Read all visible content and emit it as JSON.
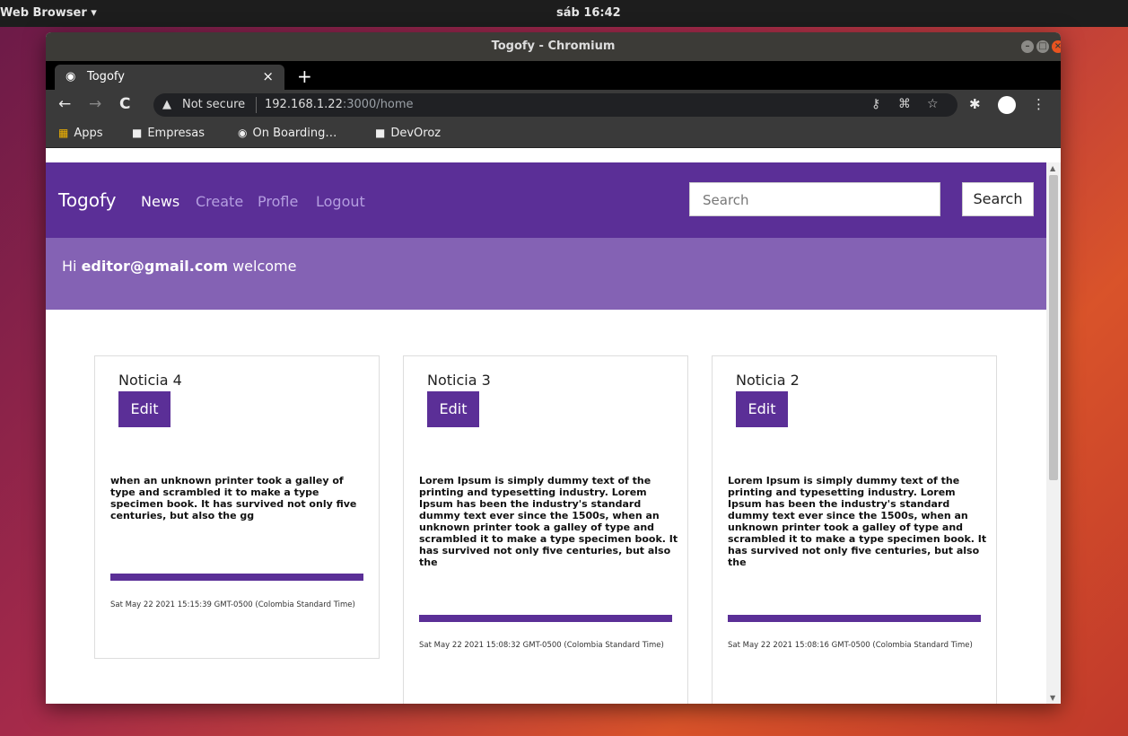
{
  "os": {
    "app_menu": "Web Browser ▾",
    "clock": "sáb 16:42"
  },
  "window": {
    "title": "Togofy - Chromium"
  },
  "tabs": [
    {
      "title": "Togofy",
      "close": "×"
    }
  ],
  "new_tab": "+",
  "omnibox": {
    "security": "Not secure",
    "host": "192.168.1.22",
    "rest": ":3000/home"
  },
  "bookmarks": [
    {
      "icon": "apps-icon",
      "label": "Apps"
    },
    {
      "icon": "folder-icon",
      "label": "Empresas"
    },
    {
      "icon": "globe-icon",
      "label": "On Boarding…"
    },
    {
      "icon": "folder-icon",
      "label": "DevOroz"
    }
  ],
  "app": {
    "brand": "Togofy",
    "nav": [
      "News",
      "Create",
      "Profle",
      "Logout"
    ],
    "search_placeholder": "Search",
    "search_button": "Search",
    "welcome": {
      "prefix": "Hi ",
      "user": "editor@gmail.com",
      "suffix": " welcome"
    }
  },
  "cards": [
    {
      "title": "Noticia 4",
      "edit": "Edit",
      "body": "when an unknown printer took a galley of type and scrambled it to make a type specimen book. It has survived not only five centuries, but also the gg",
      "date": "Sat May 22 2021 15:15:39 GMT-0500 (Colombia Standard Time)"
    },
    {
      "title": "Noticia 3",
      "edit": "Edit",
      "body": "Lorem Ipsum is simply dummy text of the printing and typesetting industry. Lorem Ipsum has been the industry's standard dummy text ever since the 1500s, when an unknown printer took a galley of type and scrambled it to make a type specimen book. It has survived not only five centuries, but also the",
      "date": "Sat May 22 2021 15:08:32 GMT-0500 (Colombia Standard Time)"
    },
    {
      "title": "Noticia 2",
      "edit": "Edit",
      "body": "Lorem Ipsum is simply dummy text of the printing and typesetting industry. Lorem Ipsum has been the industry's standard dummy text ever since the 1500s, when an unknown printer took a galley of type and scrambled it to make a type specimen book. It has survived not only five centuries, but also the",
      "date": "Sat May 22 2021 15:08:16 GMT-0500 (Colombia Standard Time)"
    }
  ]
}
